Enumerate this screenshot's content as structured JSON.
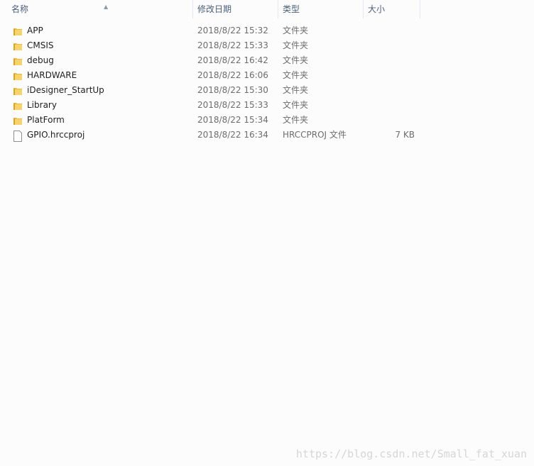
{
  "columns": {
    "name": "名称",
    "date": "修改日期",
    "type": "类型",
    "size": "大小"
  },
  "files": [
    {
      "name": "APP",
      "date": "2018/8/22 15:32",
      "type": "文件夹",
      "size": "",
      "icon": "folder-icon"
    },
    {
      "name": "CMSIS",
      "date": "2018/8/22 15:33",
      "type": "文件夹",
      "size": "",
      "icon": "folder-icon"
    },
    {
      "name": "debug",
      "date": "2018/8/22 16:42",
      "type": "文件夹",
      "size": "",
      "icon": "folder-icon"
    },
    {
      "name": "HARDWARE",
      "date": "2018/8/22 16:06",
      "type": "文件夹",
      "size": "",
      "icon": "folder-icon"
    },
    {
      "name": "iDesigner_StartUp",
      "date": "2018/8/22 15:30",
      "type": "文件夹",
      "size": "",
      "icon": "folder-icon"
    },
    {
      "name": "Library",
      "date": "2018/8/22 15:33",
      "type": "文件夹",
      "size": "",
      "icon": "folder-icon"
    },
    {
      "name": "PlatForm",
      "date": "2018/8/22 15:34",
      "type": "文件夹",
      "size": "",
      "icon": "folder-icon"
    },
    {
      "name": "GPIO.hrccproj",
      "date": "2018/8/22 16:34",
      "type": "HRCCPROJ 文件",
      "size": "7 KB",
      "icon": "file-icon"
    }
  ],
  "watermark": "https://blog.csdn.net/Small_fat_xuan"
}
